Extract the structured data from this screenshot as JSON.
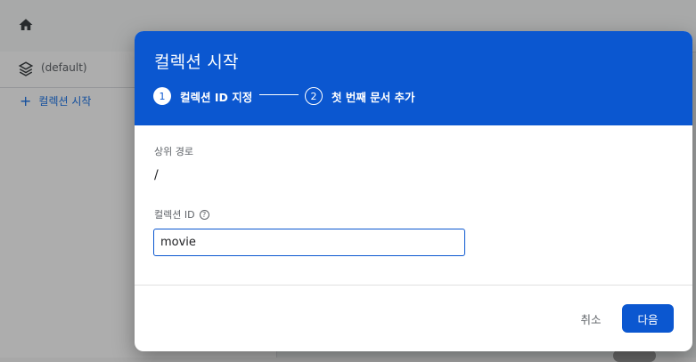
{
  "background": {
    "database_label": "(default)",
    "add_collection_label": "컬렉션 시작",
    "add_icon": "+"
  },
  "dialog": {
    "title": "컬렉션 시작",
    "steps": [
      {
        "number": "1",
        "label": "컬렉션 ID 지정",
        "state": "active"
      },
      {
        "number": "2",
        "label": "첫 번째 문서 추가",
        "state": "inactive"
      }
    ],
    "parent_path_label": "상위 경로",
    "parent_path_value": "/",
    "collection_id_label": "컬렉션 ID",
    "help_icon_glyph": "?",
    "collection_id_value": "movie",
    "cancel_label": "취소",
    "next_label": "다음"
  },
  "colors": {
    "header": "#0b57d0",
    "primary_button": "#0b57d0"
  }
}
